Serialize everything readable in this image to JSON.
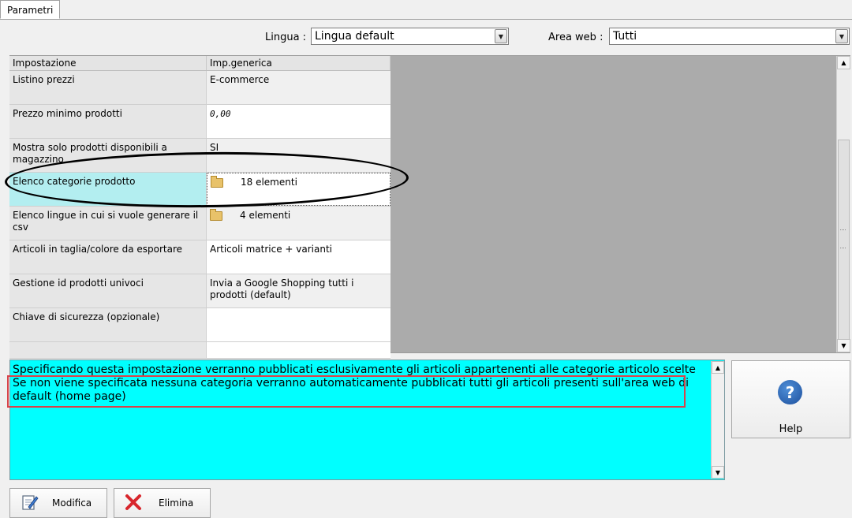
{
  "tabs": [
    {
      "label": "Parametri"
    }
  ],
  "filters": {
    "language_label": "Lingua :",
    "language_value": "Lingua default",
    "area_label": "Area web :",
    "area_value": "Tutti"
  },
  "grid": {
    "headers": [
      "Impostazione",
      "Imp.generica"
    ],
    "rows": [
      {
        "setting": "Listino prezzi",
        "value": "E-commerce"
      },
      {
        "setting": "Prezzo minimo prodotti",
        "value": "0,00"
      },
      {
        "setting": "Mostra solo prodotti disponibili a magazzino",
        "value": "SI"
      },
      {
        "setting": "Elenco categorie prodotto",
        "value": "18 elementi"
      },
      {
        "setting": "Elenco lingue in cui si vuole generare il csv",
        "value": "4 elementi"
      },
      {
        "setting": "Articoli in taglia/colore da esportare",
        "value": "Articoli matrice + varianti"
      },
      {
        "setting": "Gestione id prodotti univoci",
        "value": "Invia a Google Shopping tutti i prodotti (default)"
      },
      {
        "setting": "Chiave di sicurezza (opzionale)",
        "value": ""
      }
    ]
  },
  "description": {
    "line1": "Specificando questa impostazione verranno pubblicati esclusivamente gli articoli appartenenti alle categorie articolo scelte",
    "line2": "Se non viene specificata nessuna categoria verranno automaticamente pubblicati tutti gli articoli presenti sull'area web di default (home page)"
  },
  "buttons": {
    "help": "Help",
    "edit": "Modifica",
    "delete": "Elimina"
  },
  "colors": {
    "description_bg": "#00ffff",
    "selected_row": "#b3eef0",
    "annotation_red": "#d8434a",
    "grid_empty_area": "#ababab"
  },
  "icons": {
    "help": "question-mark-icon",
    "edit": "pencil-document-icon",
    "delete": "red-x-icon",
    "folder": "folder-icon"
  }
}
